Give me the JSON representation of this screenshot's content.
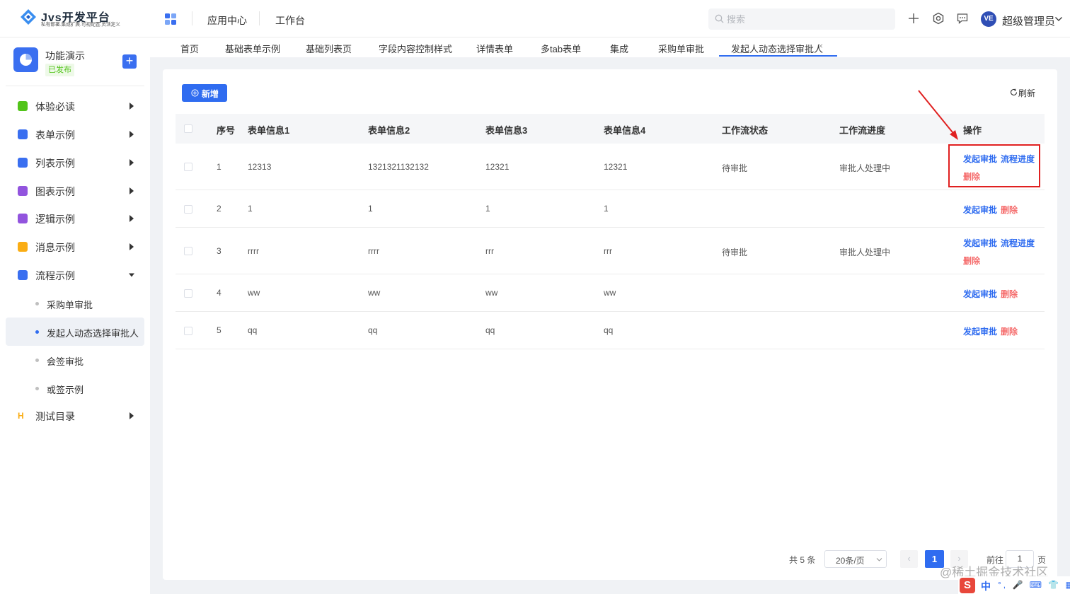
{
  "header": {
    "logo_title": "Jvs开发平台",
    "logo_subtitle": "私有部署.集成扩展.可视配置.灵活定义",
    "nav": [
      "应用中心",
      "工作台"
    ],
    "search_placeholder": "搜索",
    "user_avatar": "VE",
    "user_name": "超级管理员"
  },
  "sidebar": {
    "app_name": "功能演示",
    "app_status": "已发布",
    "menu": [
      {
        "label": "体验必读",
        "color": "#52c41a"
      },
      {
        "label": "表单示例",
        "color": "#3a6ff0"
      },
      {
        "label": "列表示例",
        "color": "#3a6ff0"
      },
      {
        "label": "图表示例",
        "color": "#9254de"
      },
      {
        "label": "逻辑示例",
        "color": "#9254de"
      },
      {
        "label": "消息示例",
        "color": "#faad14"
      },
      {
        "label": "流程示例",
        "color": "#3a6ff0"
      },
      {
        "label": "测试目录",
        "color": "#faad14"
      }
    ],
    "sub_menu": [
      "采购单审批",
      "发起人动态选择审批人",
      "会签审批",
      "或签示例"
    ]
  },
  "tabs": [
    "首页",
    "基础表单示例",
    "基础列表页",
    "字段内容控制样式",
    "详情表单",
    "多tab表单",
    "集成",
    "采购单审批",
    "发起人动态选择审批人"
  ],
  "toolbar": {
    "add_label": "新增",
    "refresh_label": "刷新"
  },
  "table": {
    "columns": [
      "序号",
      "表单信息1",
      "表单信息2",
      "表单信息3",
      "表单信息4",
      "工作流状态",
      "工作流进度",
      "操作"
    ],
    "rows": [
      {
        "no": "1",
        "f1": "12313",
        "f2": "1321321132132",
        "f3": "12321",
        "f4": "12321",
        "status": "待审批",
        "progress": "审批人处理中"
      },
      {
        "no": "2",
        "f1": "1",
        "f2": "1",
        "f3": "1",
        "f4": "1",
        "status": "",
        "progress": ""
      },
      {
        "no": "3",
        "f1": "rrrr",
        "f2": "rrrr",
        "f3": "rrr",
        "f4": "rrr",
        "status": "待审批",
        "progress": "审批人处理中"
      },
      {
        "no": "4",
        "f1": "ww",
        "f2": "ww",
        "f3": "ww",
        "f4": "ww",
        "status": "",
        "progress": ""
      },
      {
        "no": "5",
        "f1": "qq",
        "f2": "qq",
        "f3": "qq",
        "f4": "qq",
        "status": "",
        "progress": ""
      }
    ],
    "actions": {
      "start": "发起审批",
      "progress": "流程进度",
      "delete": "删除"
    }
  },
  "pagination": {
    "total": "共 5 条",
    "page_size": "20条/页",
    "current_page": "1",
    "goto_label": "前往",
    "goto_value": "1",
    "goto_unit": "页"
  },
  "watermark": "@稀土掘金技术社区",
  "ime": {
    "logo": "S",
    "mode": "中",
    "icons": "°, 🎤 ⌨ 👕 ▦"
  }
}
